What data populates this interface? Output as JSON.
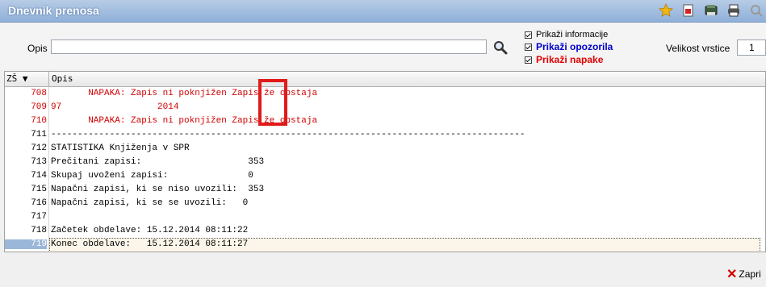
{
  "window": {
    "title": "Dnevnik prenosa"
  },
  "toolbar": {
    "icons": [
      "star-icon",
      "new-document-icon",
      "export-icon",
      "print-icon",
      "search-icon"
    ],
    "accent": "#e8a317"
  },
  "filters": {
    "opis_label": "Opis",
    "opis_value": "",
    "show_info_label": "Prikaži informacije",
    "show_warnings_label": "Prikaži opozorila",
    "show_errors_label": "Prikaži napake",
    "show_info_checked": true,
    "show_warnings_checked": true,
    "show_errors_checked": true,
    "row_size_label": "Velikost vrstice",
    "row_size_value": "1"
  },
  "grid": {
    "col_zs": "ZŠ",
    "col_opis": "Opis",
    "rows": [
      {
        "num": "708",
        "text": "       NAPAKA: Zapis ni poknjižen Zapis že obstaja",
        "type": "err"
      },
      {
        "num": "709",
        "text": "97                  2014",
        "type": "err"
      },
      {
        "num": "710",
        "text": "       NAPAKA: Zapis ni poknjižen Zapis že obstaja",
        "type": "err"
      },
      {
        "num": "711",
        "text": "-----------------------------------------------------------------------------------------",
        "type": "normal"
      },
      {
        "num": "712",
        "text": "STATISTIKA Knjiženja v SPR",
        "type": "normal"
      },
      {
        "num": "713",
        "text": "Prečitani zapisi:                    353",
        "type": "normal"
      },
      {
        "num": "714",
        "text": "Skupaj uvoženi zapisi:               0",
        "type": "normal"
      },
      {
        "num": "715",
        "text": "Napačni zapisi, ki se niso uvozili:  353",
        "type": "normal"
      },
      {
        "num": "716",
        "text": "Napačni zapisi, ki se se uvozili:   0",
        "type": "normal"
      },
      {
        "num": "717",
        "text": "",
        "type": "normal"
      },
      {
        "num": "718",
        "text": "Začetek obdelave: 15.12.2014 08:11:22",
        "type": "normal"
      },
      {
        "num": "719",
        "text": "Konec obdelave:   15.12.2014 08:11:27",
        "type": "selected"
      }
    ]
  },
  "footer": {
    "close_label": "Zapri"
  }
}
